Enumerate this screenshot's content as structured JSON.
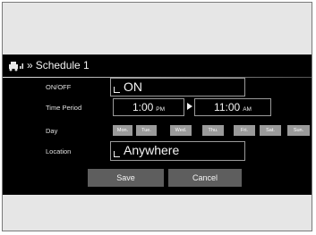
{
  "header": {
    "title": "Schedule 1",
    "icon": "car-signal-icon",
    "chevron": "»"
  },
  "rows": {
    "onoff_label": "ON/OFF",
    "time_label": "Time Period",
    "day_label": "Day",
    "location_label": "Location"
  },
  "onoff": {
    "value": "ON"
  },
  "time": {
    "start": "1:00",
    "start_ampm": "PM",
    "end": "11:00",
    "end_ampm": "AM"
  },
  "days": [
    "Mon.",
    "Tue.",
    "Wed.",
    "Thu.",
    "Fri.",
    "Sat.",
    "Sun."
  ],
  "location": {
    "value": "Anywhere"
  },
  "buttons": {
    "save": "Save",
    "cancel": "Cancel"
  },
  "colors": {
    "screen_bg": "#000000",
    "button_bg": "#5e5e5e",
    "day_bg": "#9a9a9a",
    "bezel": "#e6e6e6"
  }
}
